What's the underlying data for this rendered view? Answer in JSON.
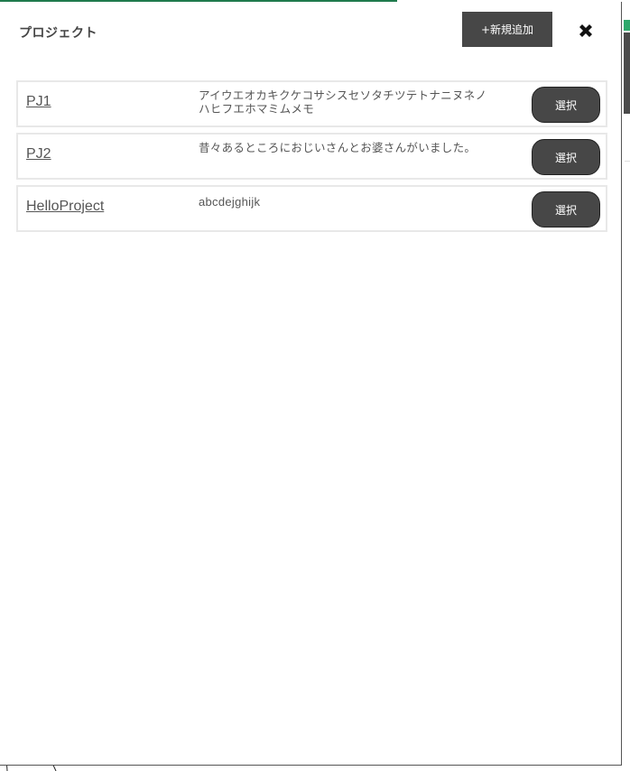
{
  "modal": {
    "title": "プロジェクト",
    "new_button_label": "+新規追加",
    "close_icon": "close-icon"
  },
  "projects": [
    {
      "name": "PJ1",
      "description": "アイウエオカキクケコサシスセソタチツテトナニヌネノハヒフエホマミムメモ",
      "select_label": "選択"
    },
    {
      "name": "PJ2",
      "description": "昔々あるところにおじいさんとお婆さんがいました。",
      "select_label": "選択"
    },
    {
      "name": "HelloProject",
      "description": "abcdejghijk",
      "select_label": "選択"
    }
  ],
  "colors": {
    "button_bg": "#474747",
    "accent_green": "#1f7a4d"
  }
}
